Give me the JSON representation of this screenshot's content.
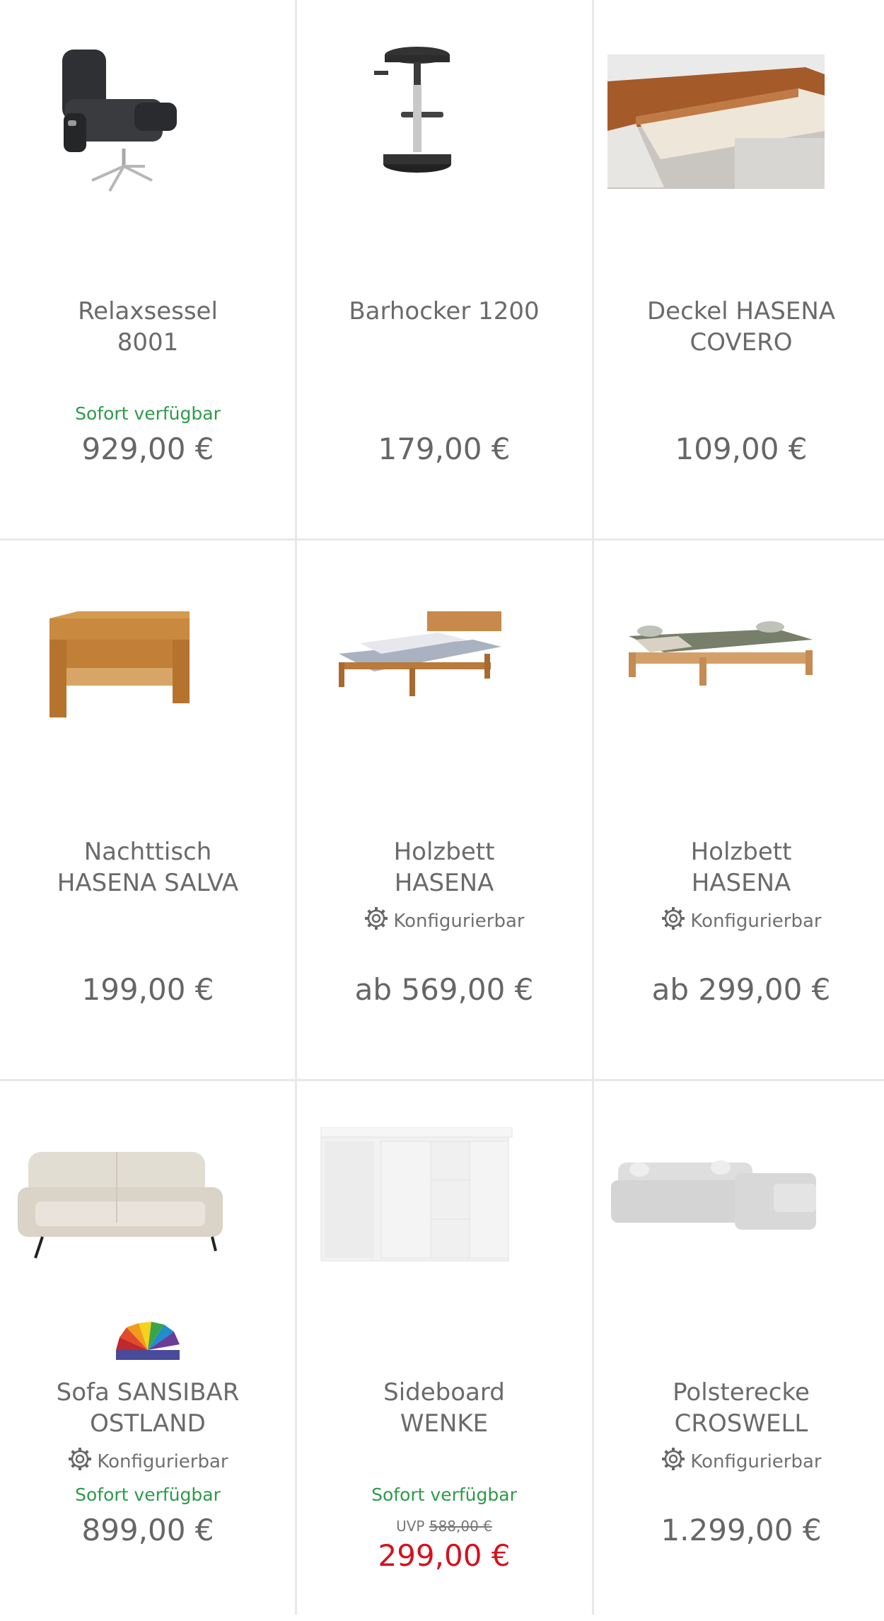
{
  "products": [
    {
      "title_1": "Relaxsessel",
      "title_2": "8001",
      "availability": "Sofort verfügbar",
      "price": "929,00 €",
      "image": "recliner-armchair-image"
    },
    {
      "title_1": "Barhocker 1200",
      "title_2": "",
      "price": "179,00 €",
      "image": "bar-stool-image"
    },
    {
      "title_1": "Deckel HASENA",
      "title_2": "COVERO",
      "price": "109,00 €",
      "image": "bed-drawer-image"
    },
    {
      "title_1": "Nachttisch",
      "title_2": "HASENA SALVA",
      "price": "199,00 €",
      "image": "nightstand-image"
    },
    {
      "title_1": "Holzbett",
      "title_2": "HASENA",
      "configurable": "Konfigurierbar",
      "price": "ab 569,00 €",
      "image": "wood-bed-image"
    },
    {
      "title_1": "Holzbett",
      "title_2": "HASENA",
      "configurable": "Konfigurierbar",
      "price": "ab 299,00 €",
      "image": "wood-bed-image"
    },
    {
      "title_1": "Sofa SANSIBAR",
      "title_2": "OSTLAND",
      "configurable": "Konfigurierbar",
      "availability": "Sofort verfügbar",
      "price": "899,00 €",
      "image": "sofa-image",
      "brand": "color-fan-logo"
    },
    {
      "title_1": "Sideboard",
      "title_2": "WENKE",
      "availability": "Sofort verfügbar",
      "uvp_label": "UVP",
      "uvp_price": "588,00 €",
      "price": "299,00 €",
      "image": "white-sideboard-image"
    },
    {
      "title_1": "Polsterecke",
      "title_2": "CROSWELL",
      "configurable": "Konfigurierbar",
      "price": "1.299,00 €",
      "image": "corner-sofa-image"
    }
  ],
  "colors": {
    "availability": "#2e9a4a",
    "sale_price": "#d4121f",
    "divider": "#e8e8e8"
  }
}
